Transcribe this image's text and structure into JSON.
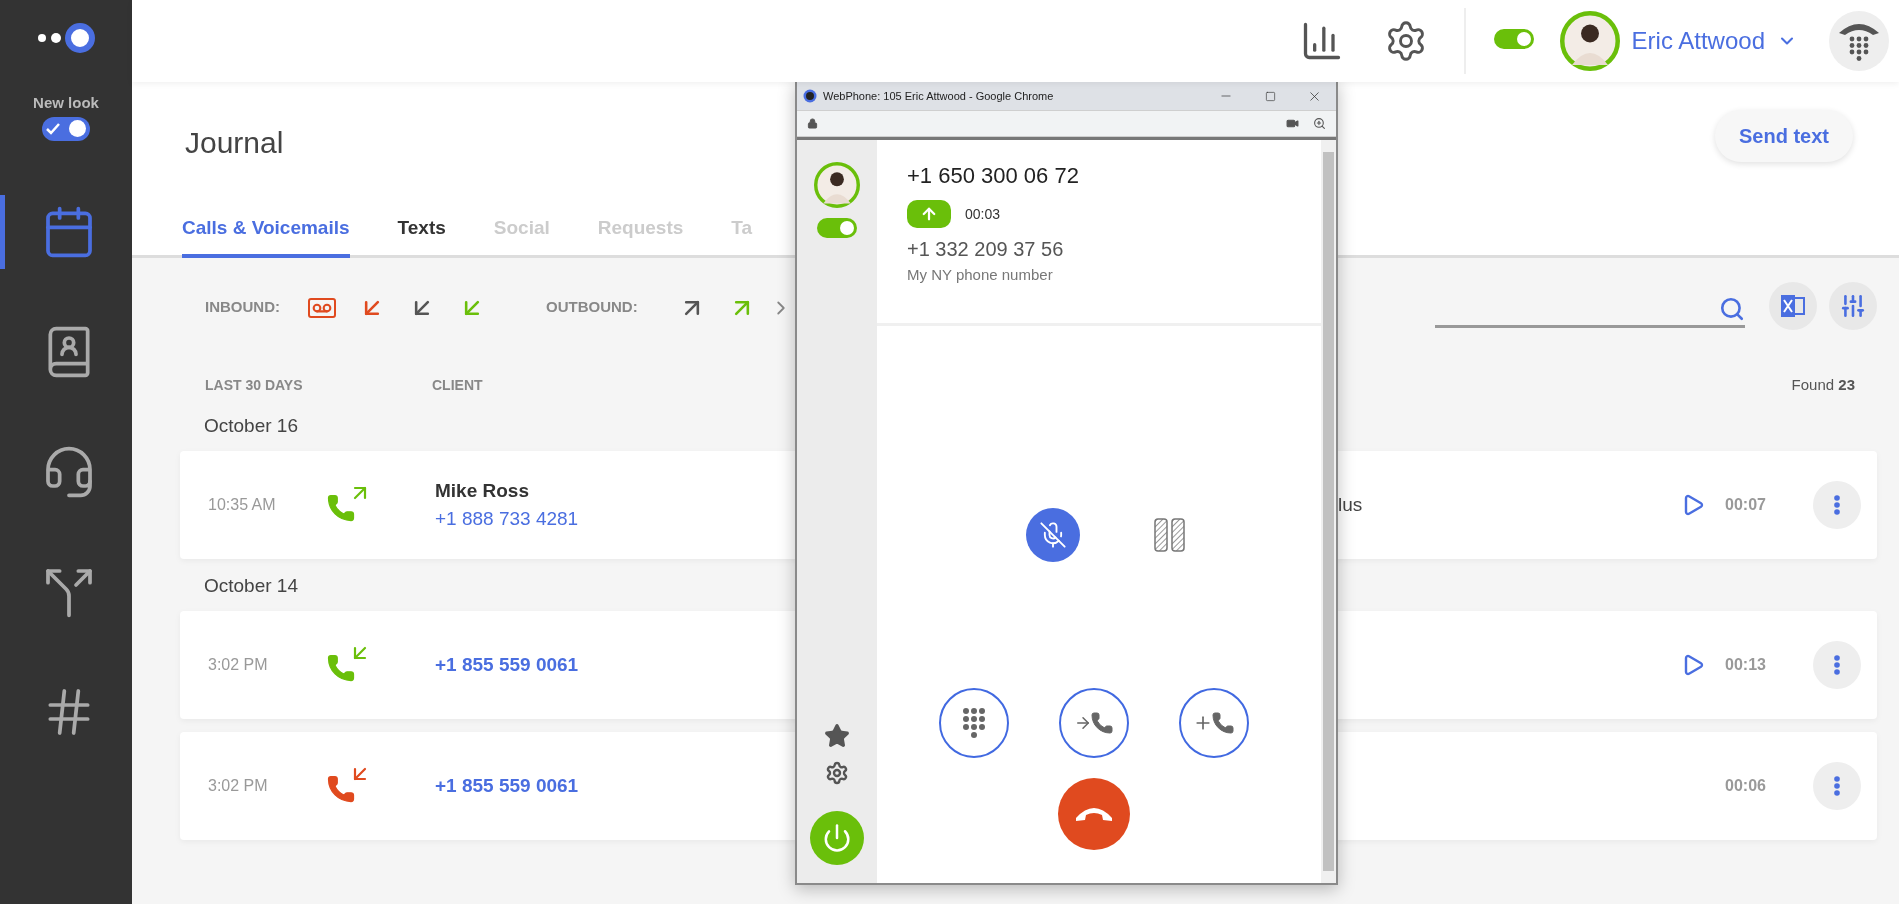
{
  "sidebar": {
    "new_look": {
      "label": "New look",
      "on": true
    },
    "items": [
      {
        "kind": "journal",
        "selected": true
      },
      {
        "kind": "contacts",
        "selected": false
      },
      {
        "kind": "agent",
        "selected": false
      },
      {
        "kind": "routing",
        "selected": false
      },
      {
        "kind": "numbers",
        "selected": false
      }
    ]
  },
  "header": {
    "status_on": true,
    "user_name": "Eric Attwood"
  },
  "page": {
    "title": "Journal",
    "send_button": "Send text"
  },
  "tabs": [
    {
      "label": "Calls & Voicemails",
      "selected": true,
      "disabled": false
    },
    {
      "label": "Texts",
      "selected": false,
      "disabled": false
    },
    {
      "label": "Social",
      "selected": false,
      "disabled": true
    },
    {
      "label": "Requests",
      "selected": false,
      "disabled": true
    },
    {
      "label": "Ta",
      "selected": false,
      "disabled": true
    }
  ],
  "filters": {
    "inbound_label": "INBOUND:",
    "inbound": [
      {
        "kind": "voicemail",
        "color": "#e04a1f"
      },
      {
        "kind": "arrow",
        "color": "#e04a1f"
      },
      {
        "kind": "arrow",
        "color": "#555555"
      },
      {
        "kind": "arrow",
        "color": "#6abf0a"
      }
    ],
    "outbound_label": "OUTBOUND:",
    "outbound": [
      {
        "kind": "arrow",
        "color": "#555555"
      },
      {
        "kind": "arrow",
        "color": "#6abf0a"
      }
    ]
  },
  "columns": [
    "LAST 30 DAYS",
    "CLIENT"
  ],
  "found": "Found **23**",
  "groups": [
    {
      "date": "October 16",
      "rows": [
        {
          "time": "10:35 AM",
          "kind": "outgoing",
          "color": "#6abf0a",
          "name": "Mike Ross",
          "phone": "+1 888 733 4281",
          "column_3": "lus",
          "recording": true,
          "duration": "00:07"
        }
      ]
    },
    {
      "date": "October 14",
      "rows": [
        {
          "time": "3:02 PM",
          "kind": "incoming",
          "color": "#6abf0a",
          "phone": "+1 855 559 0061",
          "recording": true,
          "duration": "00:13"
        },
        {
          "time": "3:02 PM",
          "kind": "incoming",
          "color": "#e04a1f",
          "phone": "+1 855 559 0061",
          "recording": false,
          "duration": "00:06"
        }
      ]
    }
  ],
  "webphone": {
    "title": "WebPhone: 105 Eric Attwood - Google Chrome",
    "available": true,
    "number": "+1 650 300 06 72",
    "kind": "outgoing",
    "timer": "00:03",
    "line_number": "+1 332 209 37 56",
    "line_label": "My NY phone number",
    "muted": true
  }
}
